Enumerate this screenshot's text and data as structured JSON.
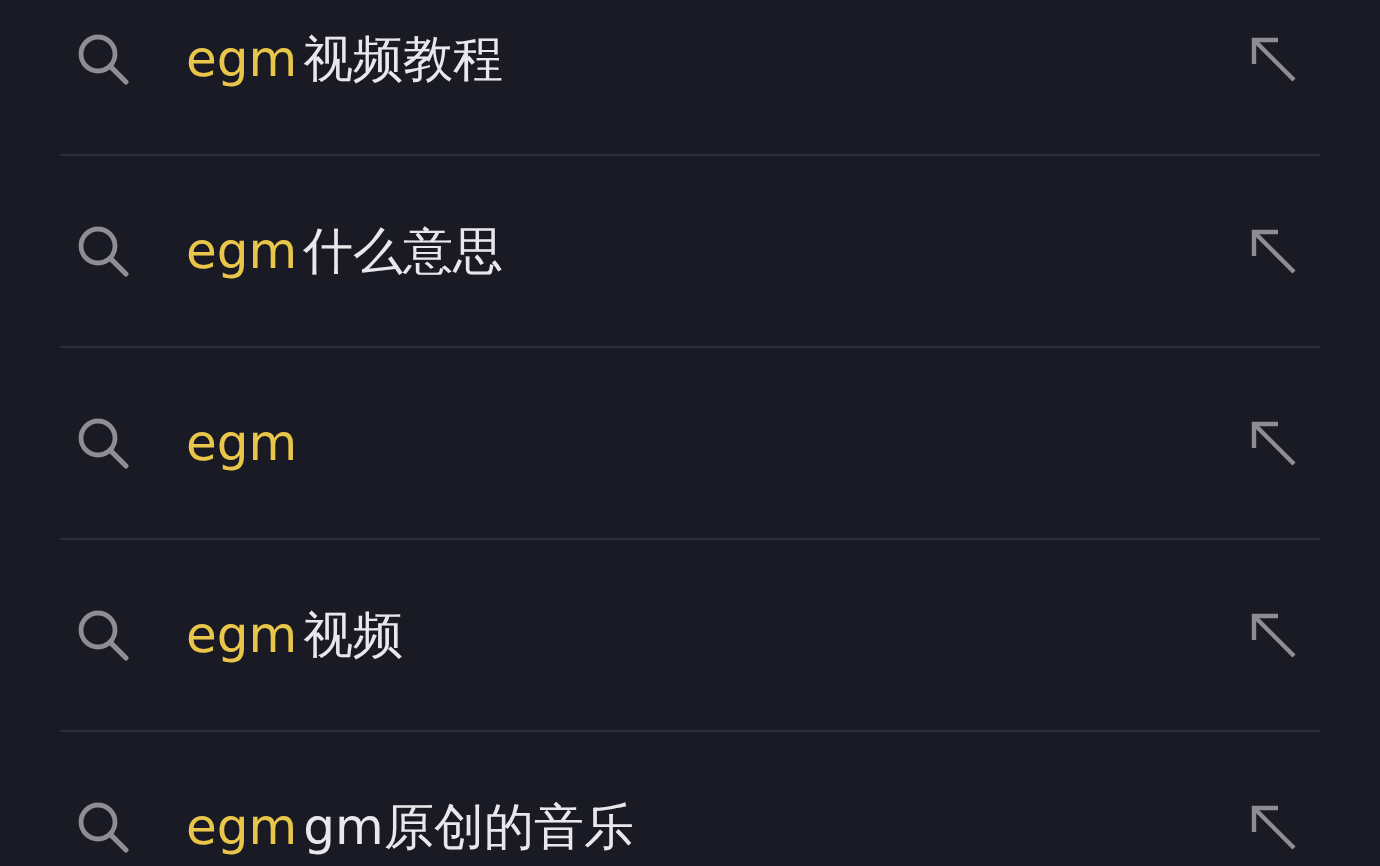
{
  "suggestions": [
    {
      "match": "egm",
      "rest": "视频教程"
    },
    {
      "match": "egm",
      "rest": "什么意思"
    },
    {
      "match": "egm"
    },
    {
      "match": "egm",
      "rest": "视频"
    },
    {
      "match": "egm",
      "rest": "gm原创的音乐"
    }
  ]
}
